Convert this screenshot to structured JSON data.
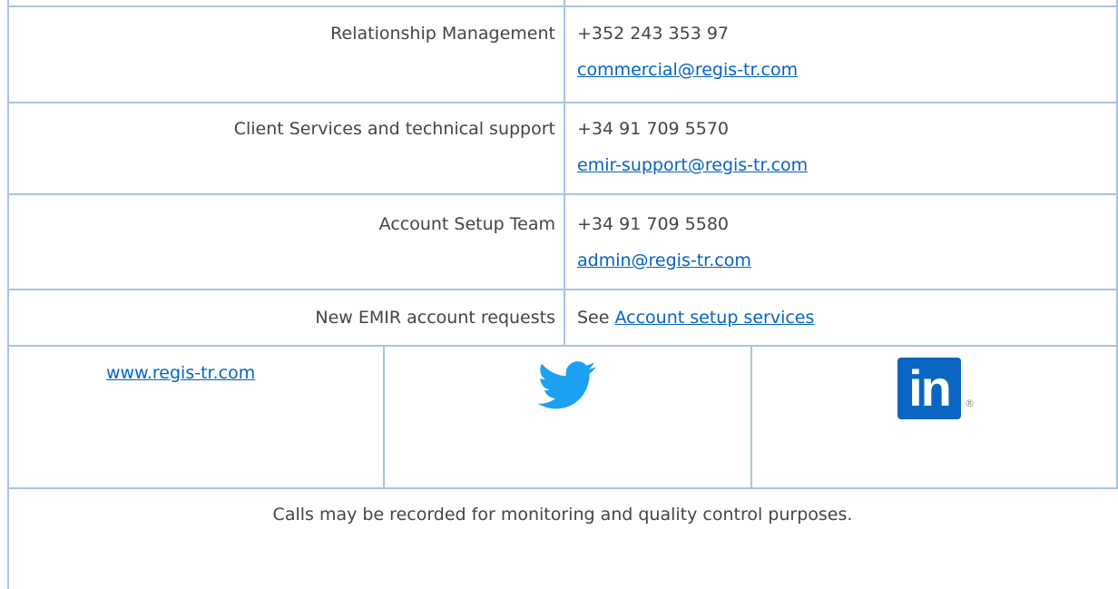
{
  "contacts": [
    {
      "label": "Relationship Management",
      "phone": "+352 243 353 97",
      "email": "commercial@regis-tr.com"
    },
    {
      "label": "Client Services and technical support",
      "phone": "+34 91 709 5570",
      "email": "emir-support@regis-tr.com"
    },
    {
      "label": "Account Setup Team",
      "phone": "+34 91 709 5580",
      "email": "admin@regis-tr.com"
    }
  ],
  "new_account": {
    "label": "New EMIR account requests",
    "prefix": "See",
    "link_text": "Account setup services"
  },
  "footer": {
    "website": "www.regis-tr.com",
    "twitter_icon": "twitter-bird-icon",
    "linkedin_icon": "linkedin-logo-icon",
    "linkedin_text": "in",
    "linkedin_mark": "®",
    "notice": "Calls may be recorded for monitoring and quality control purposes."
  },
  "colors": {
    "border": "#a8c4dc",
    "link": "#0563c1",
    "text": "#444444",
    "twitter": "#1da1f2",
    "linkedin": "#0a66c2"
  }
}
